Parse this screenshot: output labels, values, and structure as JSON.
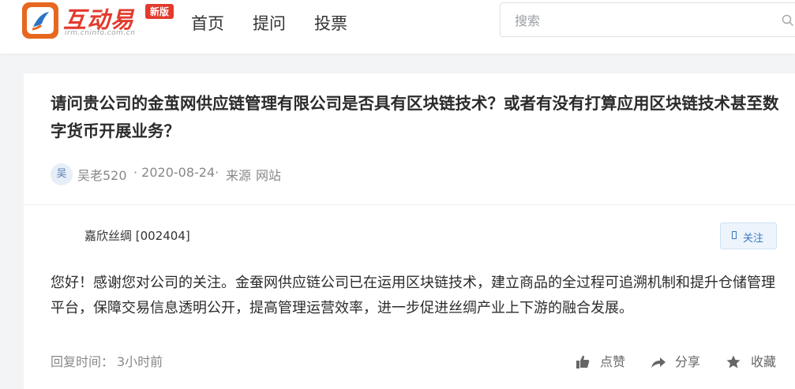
{
  "header": {
    "logo_text": "互动易",
    "logo_sub": "irm.cninfo.com.cn",
    "badge": "新版",
    "nav": [
      "首页",
      "提问",
      "投票"
    ],
    "search_placeholder": "搜索"
  },
  "question": {
    "title": "请问贵公司的金茧网供应链管理有限公司是否具有区块链技术？或者有没有打算应用区块链技术甚至数字货币开展业务？",
    "author_avatar": "吴",
    "author": "吴老520",
    "date": "· 2020-08-24·",
    "source_label": "来源",
    "source": "网站"
  },
  "answer": {
    "company": "嘉欣丝绸 [002404]",
    "follow_label": "关注",
    "text": "您好！感谢您对公司的关注。金蚕网供应链公司已在运用区块链技术，建立商品的全过程可追溯机制和提升仓储管理平台，保障交易信息透明公开，提高管理运营效率，进一步促进丝绸产业上下游的融合发展。",
    "reply_time_label": "回复时间：",
    "reply_time": "3小时前"
  },
  "actions": {
    "like": "点赞",
    "share": "分享",
    "favorite": "收藏"
  },
  "colors": {
    "brand_red": "#e23b2e",
    "brand_orange": "#e8671f",
    "link_blue": "#3a78c3"
  },
  "icons": {
    "logo": "logo-icon",
    "search": "search-icon",
    "follow": "bookmark-icon",
    "like": "thumbs-up-icon",
    "share": "share-icon",
    "favorite": "star-icon"
  }
}
